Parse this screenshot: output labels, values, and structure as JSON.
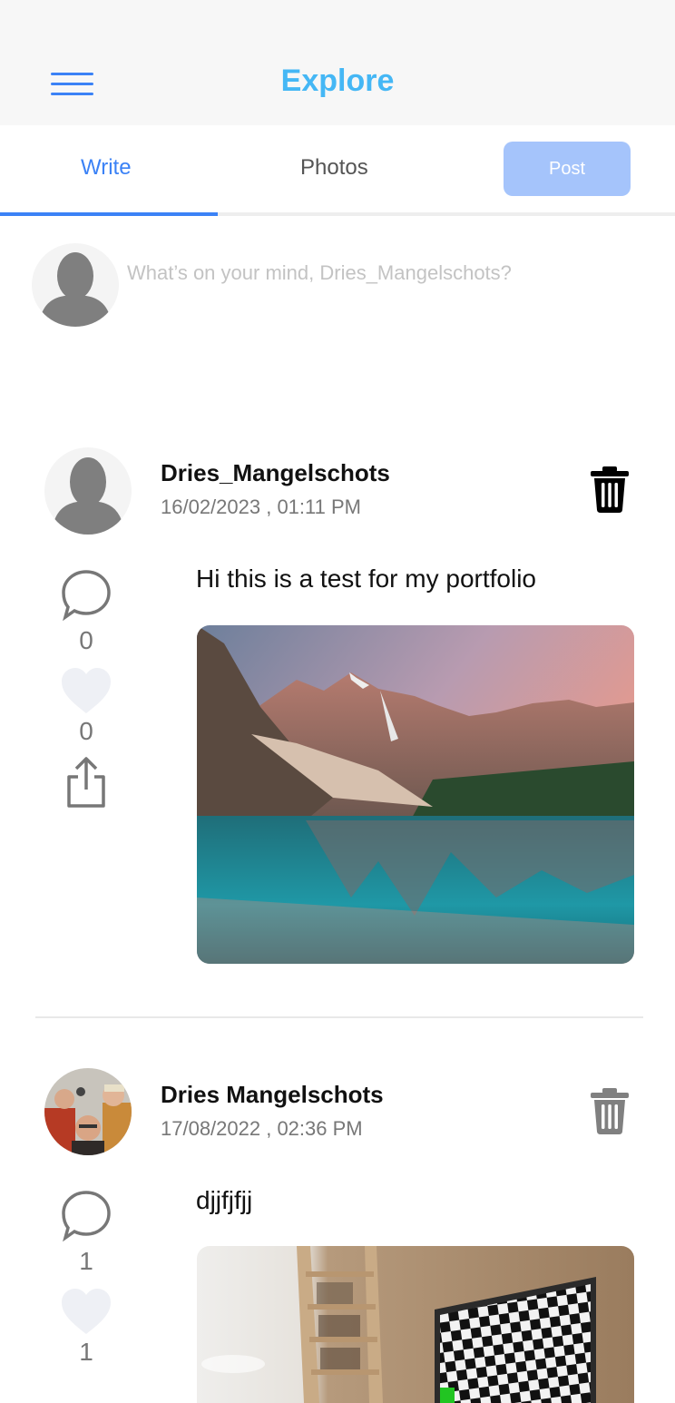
{
  "header": {
    "title": "Explore",
    "menu_icon": "hamburger-menu-icon",
    "accent": "#45b7f5"
  },
  "tabs": {
    "write_label": "Write",
    "photos_label": "Photos",
    "post_label": "Post",
    "active": "Write"
  },
  "compose": {
    "placeholder": "What’s on your mind, Dries_Mangelschots?",
    "avatar_icon": "default-user-icon"
  },
  "posts": [
    {
      "author": "Dries_Mangelschots",
      "date": "16/02/2023 , 01:11 PM",
      "text": "Hi this is a test for my portfolio",
      "comments": "0",
      "likes": "0",
      "image": "mountain-lake-photo",
      "trash_color": "#000000"
    },
    {
      "author": "Dries Mangelschots",
      "date": "17/08/2022 , 02:36 PM",
      "text": "djjfjfjj",
      "comments": "1",
      "likes": "1",
      "image": "room-checkerboard-photo",
      "trash_color": "#808080"
    }
  ]
}
